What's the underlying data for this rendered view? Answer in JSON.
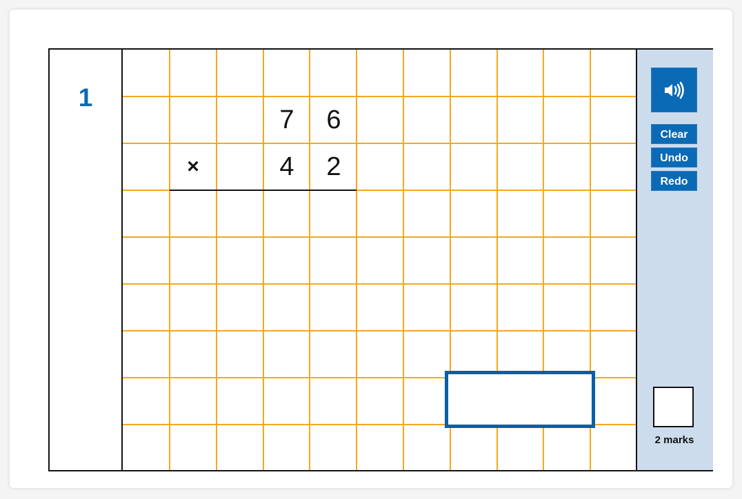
{
  "question": {
    "number": "1"
  },
  "problem": {
    "operator": "×",
    "top_digits": [
      "7",
      "6"
    ],
    "bottom_digits": [
      "4",
      "2"
    ]
  },
  "answer": {
    "value": ""
  },
  "toolbar": {
    "audio_icon": "speaker-icon",
    "clear_label": "Clear",
    "undo_label": "Undo",
    "redo_label": "Redo"
  },
  "marks": {
    "label": "2 marks",
    "value": ""
  },
  "colors": {
    "accent": "#0a6ab5",
    "grid": "#f6a81c",
    "panel_bg": "#cddced",
    "answer_border": "#0a5fa8"
  }
}
